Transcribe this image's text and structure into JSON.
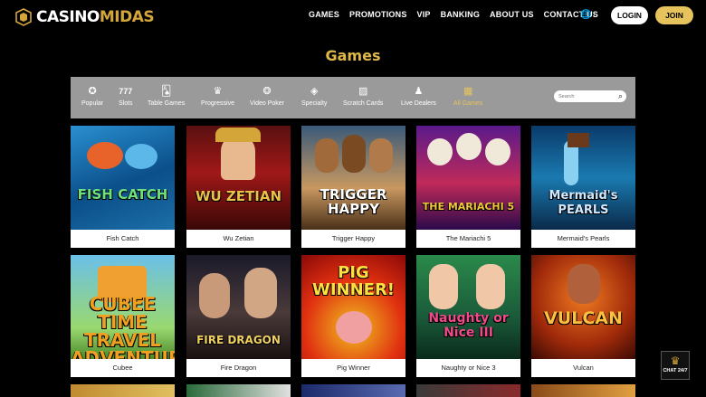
{
  "header": {
    "logo_casino": "CASINO",
    "logo_midas": "MIDAS",
    "nav": [
      "GAMES",
      "PROMOTIONS",
      "VIP",
      "BANKING",
      "ABOUT US",
      "CONTACT US"
    ],
    "language_icon": "globe-icon",
    "login_label": "LOGIN",
    "join_label": "JOIN"
  },
  "page_title": "Games",
  "categories": [
    {
      "label": "Popular",
      "icon": "star-icon"
    },
    {
      "label": "Slots",
      "icon": "slot-777-icon"
    },
    {
      "label": "Table Games",
      "icon": "cards-icon"
    },
    {
      "label": "Progressive",
      "icon": "crown-icon"
    },
    {
      "label": "Video Poker",
      "icon": "chip-icon"
    },
    {
      "label": "Specialty",
      "icon": "diamond-icon"
    },
    {
      "label": "Scratch Cards",
      "icon": "scratch-icon"
    },
    {
      "label": "Live Dealers",
      "icon": "dealer-icon"
    },
    {
      "label": "All Games",
      "icon": "all-games-icon"
    }
  ],
  "active_category": "All Games",
  "search": {
    "placeholder": "Search"
  },
  "games": [
    {
      "name": "Fish Catch",
      "art": "FISH CATCH"
    },
    {
      "name": "Wu Zetian",
      "art": "WU ZETIAN"
    },
    {
      "name": "Trigger Happy",
      "art": "TRIGGER HAPPY"
    },
    {
      "name": "The Mariachi 5",
      "art": "THE MARIACHI 5"
    },
    {
      "name": "Mermaid's Pearls",
      "art": "Mermaid's PEARLS"
    },
    {
      "name": "Cubee",
      "art": "CUBEE TIME TRAVEL ADVENTURE"
    },
    {
      "name": "Fire Dragon",
      "art": "FIRE DRAGON"
    },
    {
      "name": "Pig Winner",
      "art": "PIG WINNER!"
    },
    {
      "name": "Naughty or Nice 3",
      "art": "Naughty or Nice III"
    },
    {
      "name": "Vulcan",
      "art": "VULCAN"
    }
  ],
  "colors": {
    "brand_gold": "#e6c35c",
    "category_bar": "#9a9a9a",
    "background": "#000000"
  },
  "chat": {
    "label": "CHAT 24/7",
    "icon": "crown-icon"
  }
}
